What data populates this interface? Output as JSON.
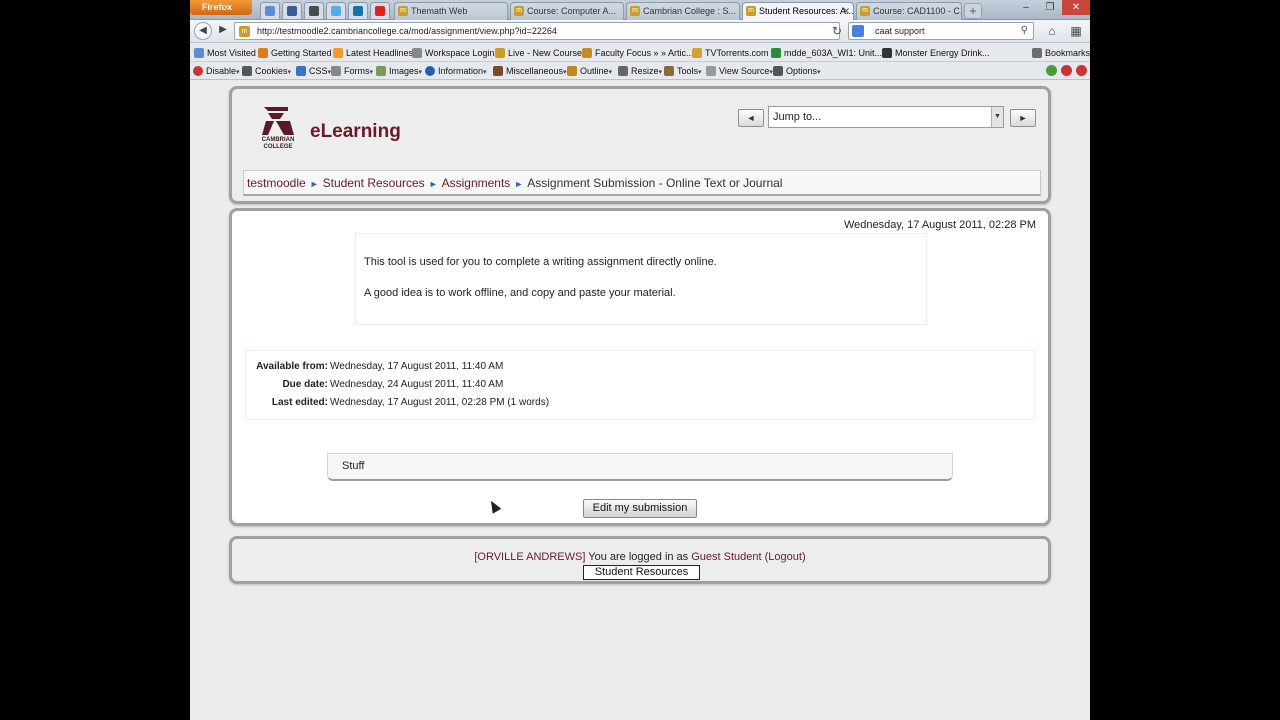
{
  "browser": {
    "firefox_label": "Firefox",
    "tabs": [
      {
        "label": "Themath Web"
      },
      {
        "label": "Course: Computer A..."
      },
      {
        "label": "Cambrian College : S..."
      },
      {
        "label": "Student Resources: A..."
      },
      {
        "label": "Course: CAD1100 - C..."
      }
    ],
    "url": "http://testmoodle2.cambriancollege.ca/mod/assignment/view.php?id=22264",
    "search": "caat support",
    "bookmarks": [
      "Most Visited",
      "Getting Started",
      "Latest Headlines",
      "Workspace Login",
      "Live - New Course",
      "Faculty Focus » » Artic...",
      "TVTorrents.com",
      "mdde_603A_WI1: Unit...",
      "Monster Energy Drink..."
    ],
    "bookmarks_menu": "Bookmarks",
    "devtools": [
      "Disable",
      "Cookies",
      "CSS",
      "Forms",
      "Images",
      "Information",
      "Miscellaneous",
      "Outline",
      "Resize",
      "Tools",
      "View Source",
      "Options"
    ]
  },
  "header": {
    "logo_text": "CAMBRIAN COLLEGE",
    "site_title": "eLearning",
    "jump_placeholder": "Jump to...",
    "prev_glyph": "◄",
    "next_glyph": "►"
  },
  "breadcrumb": {
    "items": [
      "testmoodle",
      "Student Resources",
      "Assignments"
    ],
    "current": "Assignment Submission - Online Text or Journal",
    "separator": "►"
  },
  "main": {
    "date": "Wednesday, 17 August 2011, 02:28 PM",
    "intro": [
      "This tool is used for you to complete a writing assignment directly online.",
      "A good idea is to work offline, and copy and paste your material."
    ],
    "dates": [
      {
        "label": "Available from:",
        "value": "Wednesday, 17 August 2011, 11:40 AM"
      },
      {
        "label": "Due date:",
        "value": "Wednesday, 24 August 2011, 11:40 AM"
      },
      {
        "label": "Last edited:",
        "value": "Wednesday, 17 August 2011, 02:28 PM (1 words)"
      }
    ],
    "submission_text": "Stuff",
    "edit_button": "Edit my submission"
  },
  "footer": {
    "user_tag": "[ORVILLE ANDREWS]",
    "logged_in_text": "You are logged in as",
    "user_name": "Guest Student",
    "logout": "(Logout)",
    "home_button": "Student Resources"
  },
  "colors": {
    "brand": "#6b1a2a",
    "link_arrow": "#2a64c5",
    "firefox_orange": "#e07a1f"
  }
}
